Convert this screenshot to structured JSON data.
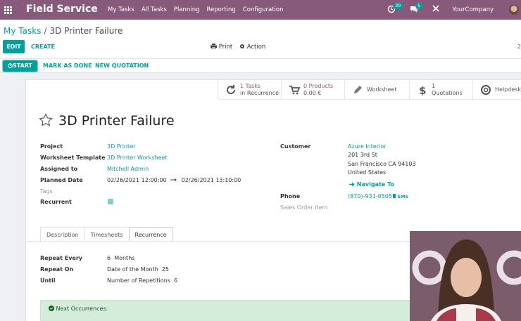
{
  "navbar": {
    "brand": "Field Service",
    "menu": [
      "My Tasks",
      "All Tasks",
      "Planning",
      "Reporting",
      "Configuration"
    ],
    "activity_count": "30",
    "message_count": "5",
    "company": "YourCompany"
  },
  "breadcrumb": {
    "parent": "My Tasks",
    "separator": "/",
    "current": "3D Printer Failure"
  },
  "toolbar": {
    "edit": "EDIT",
    "create": "CREATE",
    "print": "Print",
    "action": "Action",
    "pager": "2"
  },
  "statusbar": {
    "start": "START",
    "mark_done": "MARK AS DONE",
    "new_quotation": "NEW QUOTATION"
  },
  "smart_buttons": [
    {
      "line1": "1 Tasks",
      "line2": "in Recurrence",
      "icon": "refresh-icon"
    },
    {
      "line1": "0 Products",
      "line2": "0.00 €",
      "icon": "cart-icon"
    },
    {
      "line1": "Worksheet",
      "line2": "",
      "icon": "pencil-icon"
    },
    {
      "line1": "1",
      "line2": "Quotations",
      "icon": "dollar-icon"
    },
    {
      "line1": "Helpdesk",
      "line2": "",
      "icon": "lifebuoy-icon"
    }
  ],
  "task": {
    "title": "3D Printer Failure",
    "labels": {
      "project": "Project",
      "worksheet_template": "Worksheet Template",
      "assigned_to": "Assigned to",
      "planned_date": "Planned Date",
      "tags": "Tags",
      "recurrent": "Recurrent",
      "customer": "Customer",
      "phone": "Phone",
      "sales_order_item": "Sales Order Item"
    },
    "project": "3D Printer",
    "worksheet_template": "3D Printer Worksheet",
    "assigned_to": "Mitchell Admin",
    "planned_start": "02/26/2021 12:00:00",
    "planned_end": "02/26/2021 13:10:00",
    "customer": {
      "name": "Azure Interior",
      "street": "201 3rd St",
      "city": "San Francisco CA 94103",
      "country": "United States",
      "navigate": "Navigate To"
    },
    "phone": "(870)-931-0505",
    "sms": "SMS"
  },
  "tabs": [
    "Description",
    "Timesheets",
    "Recurrence"
  ],
  "recurrence": {
    "labels": {
      "repeat_every": "Repeat Every",
      "repeat_on": "Repeat On",
      "until": "Until"
    },
    "repeat_every_value": "6",
    "repeat_every_unit": "Months",
    "repeat_on_text": "Date of the Month",
    "repeat_on_value": "25",
    "until_text": "Number of Repetitions",
    "until_value": "6",
    "next_occurrences": "Next Occurrences:"
  },
  "colors": {
    "brand": "#875a7b",
    "accent": "#00a09d"
  }
}
